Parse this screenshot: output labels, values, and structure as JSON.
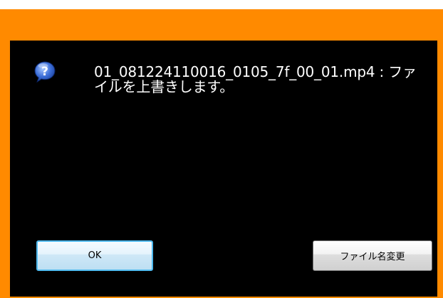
{
  "dialog": {
    "message": "01_081224110016_0105_7f_00_01.mp4 : ファイルを上書きします。",
    "icon": "question-icon",
    "colors": {
      "frame": "#ff8a00",
      "body": "#000000",
      "text": "#ffffff",
      "ok_focus_border": "#4fb9ee"
    }
  },
  "buttons": {
    "ok_label": "OK",
    "rename_label": "ファイル名変更"
  }
}
